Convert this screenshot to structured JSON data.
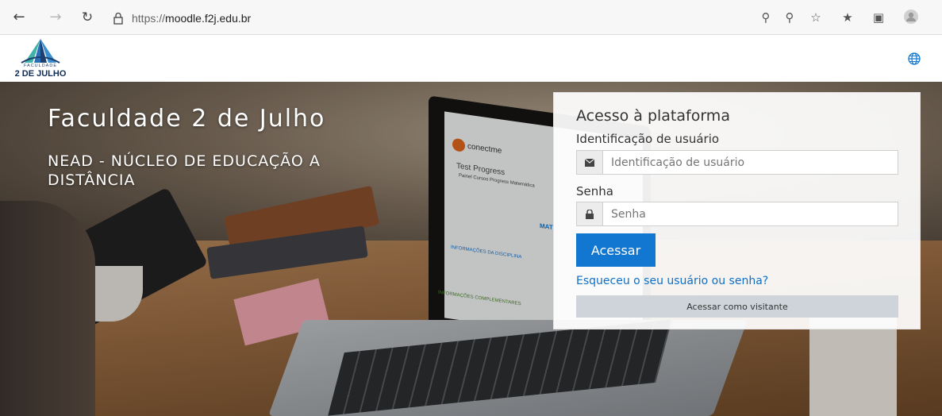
{
  "browser": {
    "url_prefix": "https://",
    "url_domain": "moodle.f2j.edu.br"
  },
  "header": {
    "logo_small": "FACULDADE",
    "logo_big": "2 DE JULHO"
  },
  "hero": {
    "title": "Faculdade 2 de Julho",
    "subtitle": "NEAD - NÚCLEO DE EDUCAÇÃO A DISTÂNCIA",
    "screen_brand": "conectme",
    "screen_heading": "Test Progress",
    "screen_tabs": "Painel   Cursos   Progress   Matemática",
    "screen_section1": "INFORMAÇÕES DA DISCIPLINA",
    "screen_section2": "INFORMAÇÕES COMPLEMENTARES",
    "screen_label": "MAT"
  },
  "login": {
    "title": "Acesso à plataforma",
    "username_label": "Identificação de usuário",
    "username_placeholder": "Identificação de usuário",
    "password_label": "Senha",
    "password_placeholder": "Senha",
    "submit_label": "Acessar",
    "forgot_link": "Esqueceu o seu usuário ou senha?",
    "guest_label": "Acessar como visitante"
  },
  "colors": {
    "primary_button": "#1177d1",
    "link": "#0f6fc5",
    "guest_button": "#ced4da"
  }
}
